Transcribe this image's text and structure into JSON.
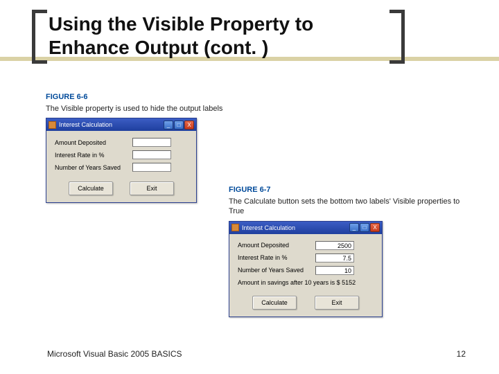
{
  "title": "Using the Visible Property to Enhance Output (cont. )",
  "figure1": {
    "label": "FIGURE 6-6",
    "caption": "The Visible property is used to hide the output labels",
    "window_title": "Interest Calculation",
    "rows": {
      "amount_label": "Amount Deposited",
      "rate_label": "Interest Rate in %",
      "years_label": "Number of Years Saved"
    },
    "buttons": {
      "calculate": "Calculate",
      "exit": "Exit"
    }
  },
  "figure2": {
    "label": "FIGURE 6-7",
    "caption": "The Calculate button sets the bottom two labels' Visible properties to True",
    "window_title": "Interest Calculation",
    "rows": {
      "amount_label": "Amount Deposited",
      "amount_value": "2500",
      "rate_label": "Interest Rate in %",
      "rate_value": "7.5",
      "years_label": "Number of Years Saved",
      "years_value": "10"
    },
    "result": "Amount in savings after  10  years is $  5152",
    "buttons": {
      "calculate": "Calculate",
      "exit": "Exit"
    }
  },
  "footer": "Microsoft Visual Basic 2005 BASICS",
  "page_number": "12",
  "win_controls": {
    "min": "_",
    "max": "□",
    "close": "X"
  }
}
